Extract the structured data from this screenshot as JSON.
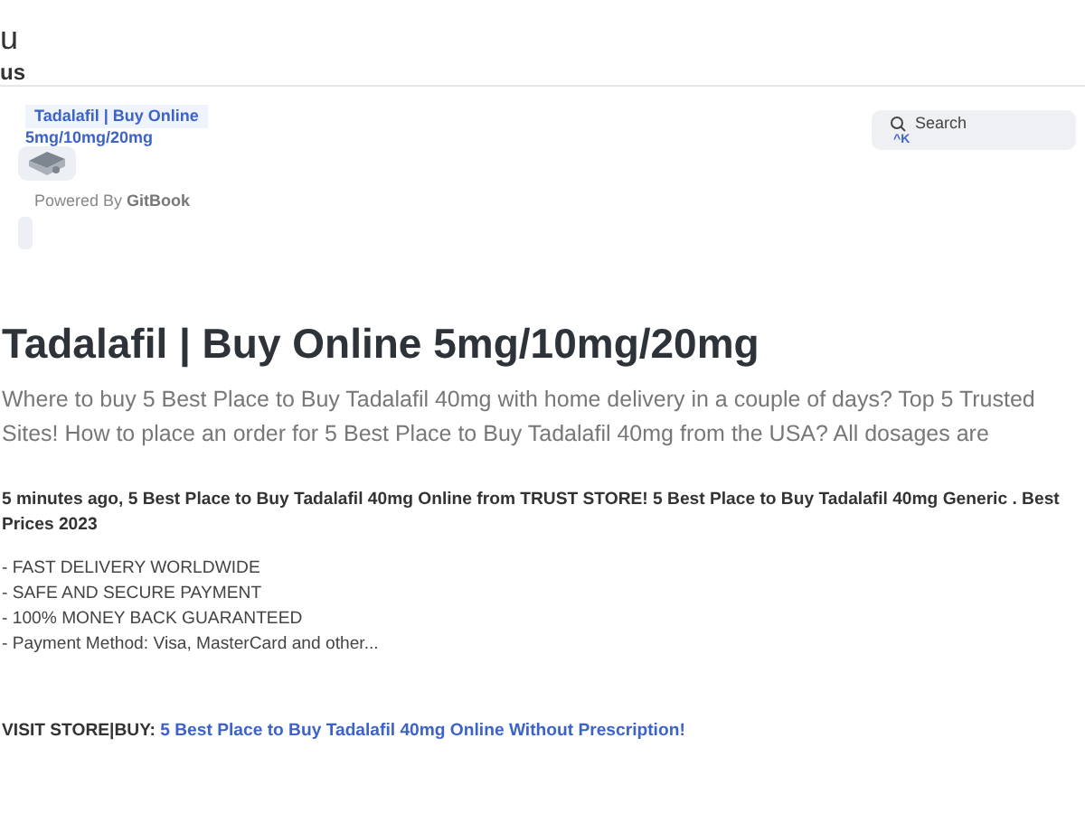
{
  "top_texts": [
    "u",
    "us"
  ],
  "header": {
    "site_link": "Tadalafil | Buy Online",
    "site_link_continued": "5mg/10mg/20mg",
    "powered_by": "Powered By ",
    "powered_brand": "GitBook",
    "search": {
      "placeholder": "Search",
      "shortcut": "^K"
    }
  },
  "article": {
    "title": "Tadalafil | Buy Online 5mg/10mg/20mg",
    "description": "Where to buy 5 Best Place to Buy Tadalafil 40mg with home delivery in a couple of days? Top 5 Trusted Sites! How to place an order for 5 Best Place to Buy Tadalafil 40mg from the USA? All dosages are",
    "lead": "5 minutes ago, 5 Best Place to Buy Tadalafil 40mg Online from TRUST STORE! 5 Best Place to Buy Tadalafil 40mg Generic . Best Prices 2023",
    "features": [
      "- FAST DELIVERY WORLDWIDE",
      "- SAFE AND SECURE PAYMENT",
      "- 100% MONEY BACK GUARANTEED",
      "- Payment Method: Visa, MasterCard and other..."
    ],
    "visit_label": "VISIT STORE|BUY:",
    "visit_link": "5 Best Place to Buy Tadalafil 40mg Online Without Prescription!"
  }
}
